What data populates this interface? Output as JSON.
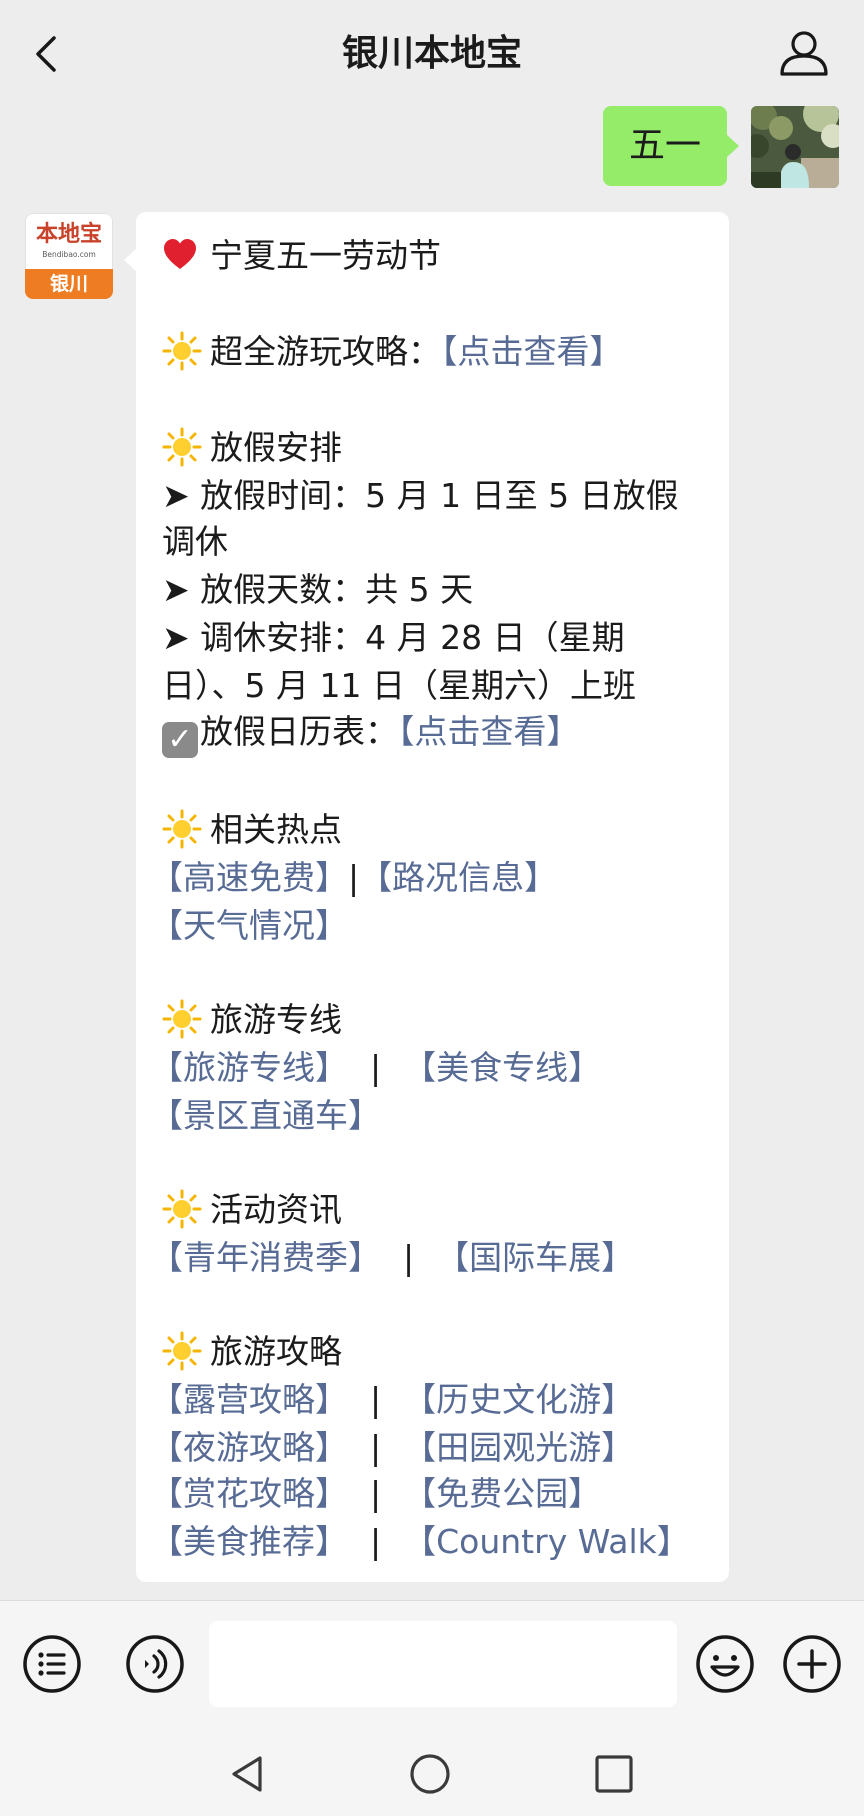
{
  "header": {
    "title": "银川本地宝",
    "back_icon": "chevron-left-icon",
    "user_icon": "user-icon"
  },
  "outgoing_message": {
    "text": "五一",
    "bubble_color": "#95ec69"
  },
  "bot_avatar": {
    "logo_text": "本地宝",
    "logo_url": "Bendibao.com",
    "logo_city": "银川"
  },
  "incoming_message": {
    "headline": "宁夏五一劳动节",
    "guide": {
      "label": "超全游玩攻略：",
      "link": "【点击查看】"
    },
    "holiday_section": "放假安排",
    "holiday_time_1": "➤ 放假时间：5 月 1 日至 5 日放假",
    "holiday_time_2": "调休",
    "holiday_days": "➤ 放假天数：共 5 天",
    "workday_1": "➤ 调休安排：4 月 28 日（星期",
    "workday_2": "日）、5 月 11 日（星期六）上班",
    "calendar": {
      "label": "放假日历表：",
      "link": "【点击查看】"
    },
    "hot_section": "相关热点",
    "hot_link_1": "【高速免费】",
    "hot_sep": "|",
    "hot_link_2": "【路况信息】",
    "hot_link_3": "【天气情况】",
    "line_section": "旅游专线",
    "line_link_1": "【旅游专线】",
    "line_sep": "|",
    "line_link_2": "【美食专线】",
    "line_link_3": "【景区直通车】",
    "event_section": "活动资讯",
    "event_link_1": "【青年消费季】",
    "event_sep": "|",
    "event_link_2": "【国际车展】",
    "travel_section": "旅游攻略",
    "travel_rows": [
      {
        "left": "【露营攻略】",
        "sep": "|",
        "right": "【历史文化游】"
      },
      {
        "left": "【夜游攻略】",
        "sep": "|",
        "right": "【田园观光游】"
      },
      {
        "left": "【赏花攻略】",
        "sep": "|",
        "right": "【免费公园】"
      },
      {
        "left": "【美食推荐】",
        "sep": "|",
        "right": "【Country Walk】"
      }
    ],
    "link_color": "#576b95"
  },
  "input_bar": {
    "menu_icon": "list-icon",
    "voice_icon": "voice-icon",
    "emoji_icon": "emoji-icon",
    "plus_icon": "plus-icon",
    "input_value": ""
  },
  "system_nav": {
    "back_icon": "triangle-back-icon",
    "home_icon": "circle-home-icon",
    "recents_icon": "square-recents-icon"
  }
}
